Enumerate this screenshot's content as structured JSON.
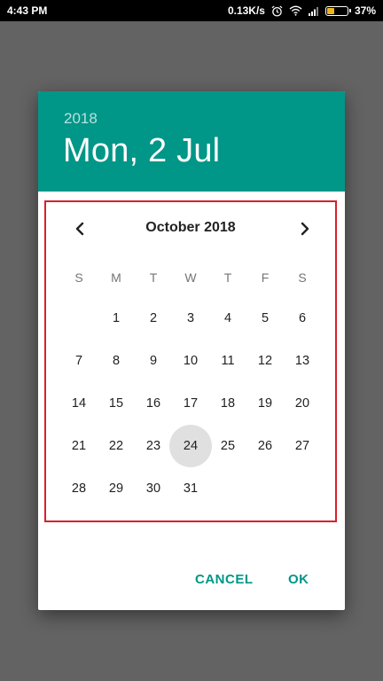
{
  "status_bar": {
    "time": "4:43 PM",
    "speed": "0.13K/s",
    "battery": "37%",
    "battery_level": 0.37,
    "battery_color": "#f0b51d"
  },
  "dialog": {
    "header": {
      "year": "2018",
      "date": "Mon, 2 Jul",
      "color": "#009688"
    },
    "calendar": {
      "month_title": "October 2018",
      "weekdays": [
        "S",
        "M",
        "T",
        "W",
        "T",
        "F",
        "S"
      ],
      "leading_blanks": 1,
      "days": [
        "1",
        "2",
        "3",
        "4",
        "5",
        "6",
        "7",
        "8",
        "9",
        "10",
        "11",
        "12",
        "13",
        "14",
        "15",
        "16",
        "17",
        "18",
        "19",
        "20",
        "21",
        "22",
        "23",
        "24",
        "25",
        "26",
        "27",
        "28",
        "29",
        "30",
        "31"
      ],
      "selected_day": "24",
      "highlight_border_color": "#d9202a"
    },
    "actions": {
      "cancel_label": "CANCEL",
      "ok_label": "OK"
    }
  }
}
